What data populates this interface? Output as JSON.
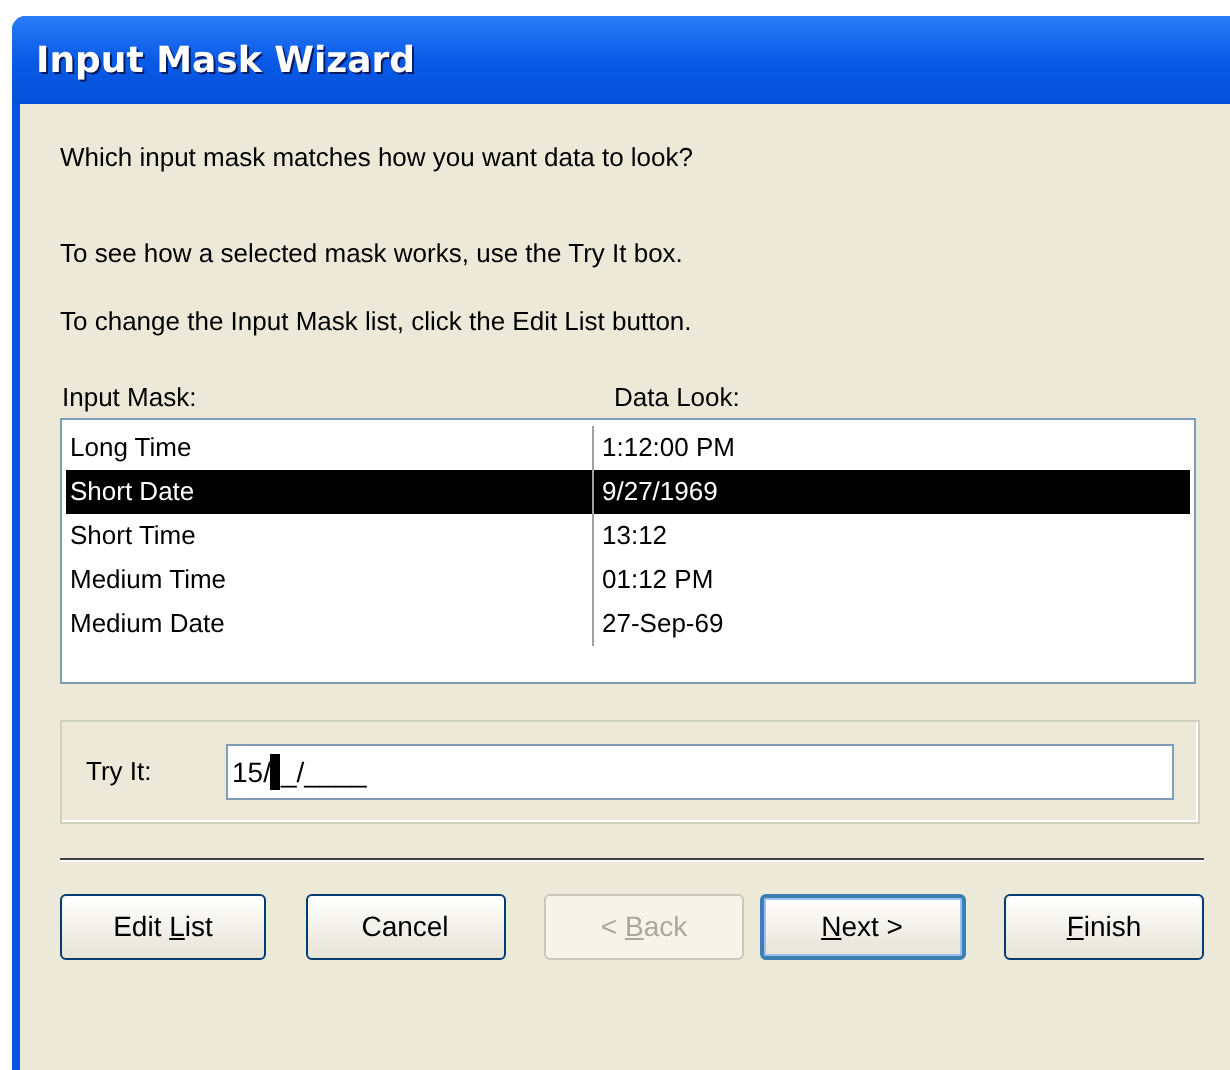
{
  "window": {
    "title": "Input Mask Wizard"
  },
  "question": "Which input mask matches how you want data to look?",
  "hints": [
    "To see how a selected mask works, use the Try It box.",
    "To change the Input Mask list, click the Edit List button."
  ],
  "table": {
    "columns": [
      "Input Mask:",
      "Data Look:"
    ],
    "rows": [
      {
        "cells": [
          "Long Time",
          "1:12:00 PM"
        ],
        "selected": false
      },
      {
        "cells": [
          "Short Date",
          "9/27/1969"
        ],
        "selected": true
      },
      {
        "cells": [
          "Short Time",
          "13:12"
        ],
        "selected": false
      },
      {
        "cells": [
          "Medium Time",
          "01:12 PM"
        ],
        "selected": false
      },
      {
        "cells": [
          "Medium Date",
          "27-Sep-69"
        ],
        "selected": false
      }
    ]
  },
  "try_it": {
    "label": "Try It:",
    "value_before_cursor": "15/",
    "value_after_cursor": "_/____",
    "cursor": true
  },
  "buttons": [
    {
      "before": "Edit ",
      "key": "L",
      "after": "ist",
      "disabled": false,
      "default": false
    },
    {
      "before": "Cancel",
      "disabled": false,
      "default": false
    },
    {
      "before": "< ",
      "key": "B",
      "after": "ack",
      "disabled": true,
      "default": false
    },
    {
      "key": "N",
      "after": "ext >",
      "disabled": false,
      "default": true
    },
    {
      "key": "F",
      "after": "inish",
      "disabled": false,
      "default": false
    }
  ]
}
